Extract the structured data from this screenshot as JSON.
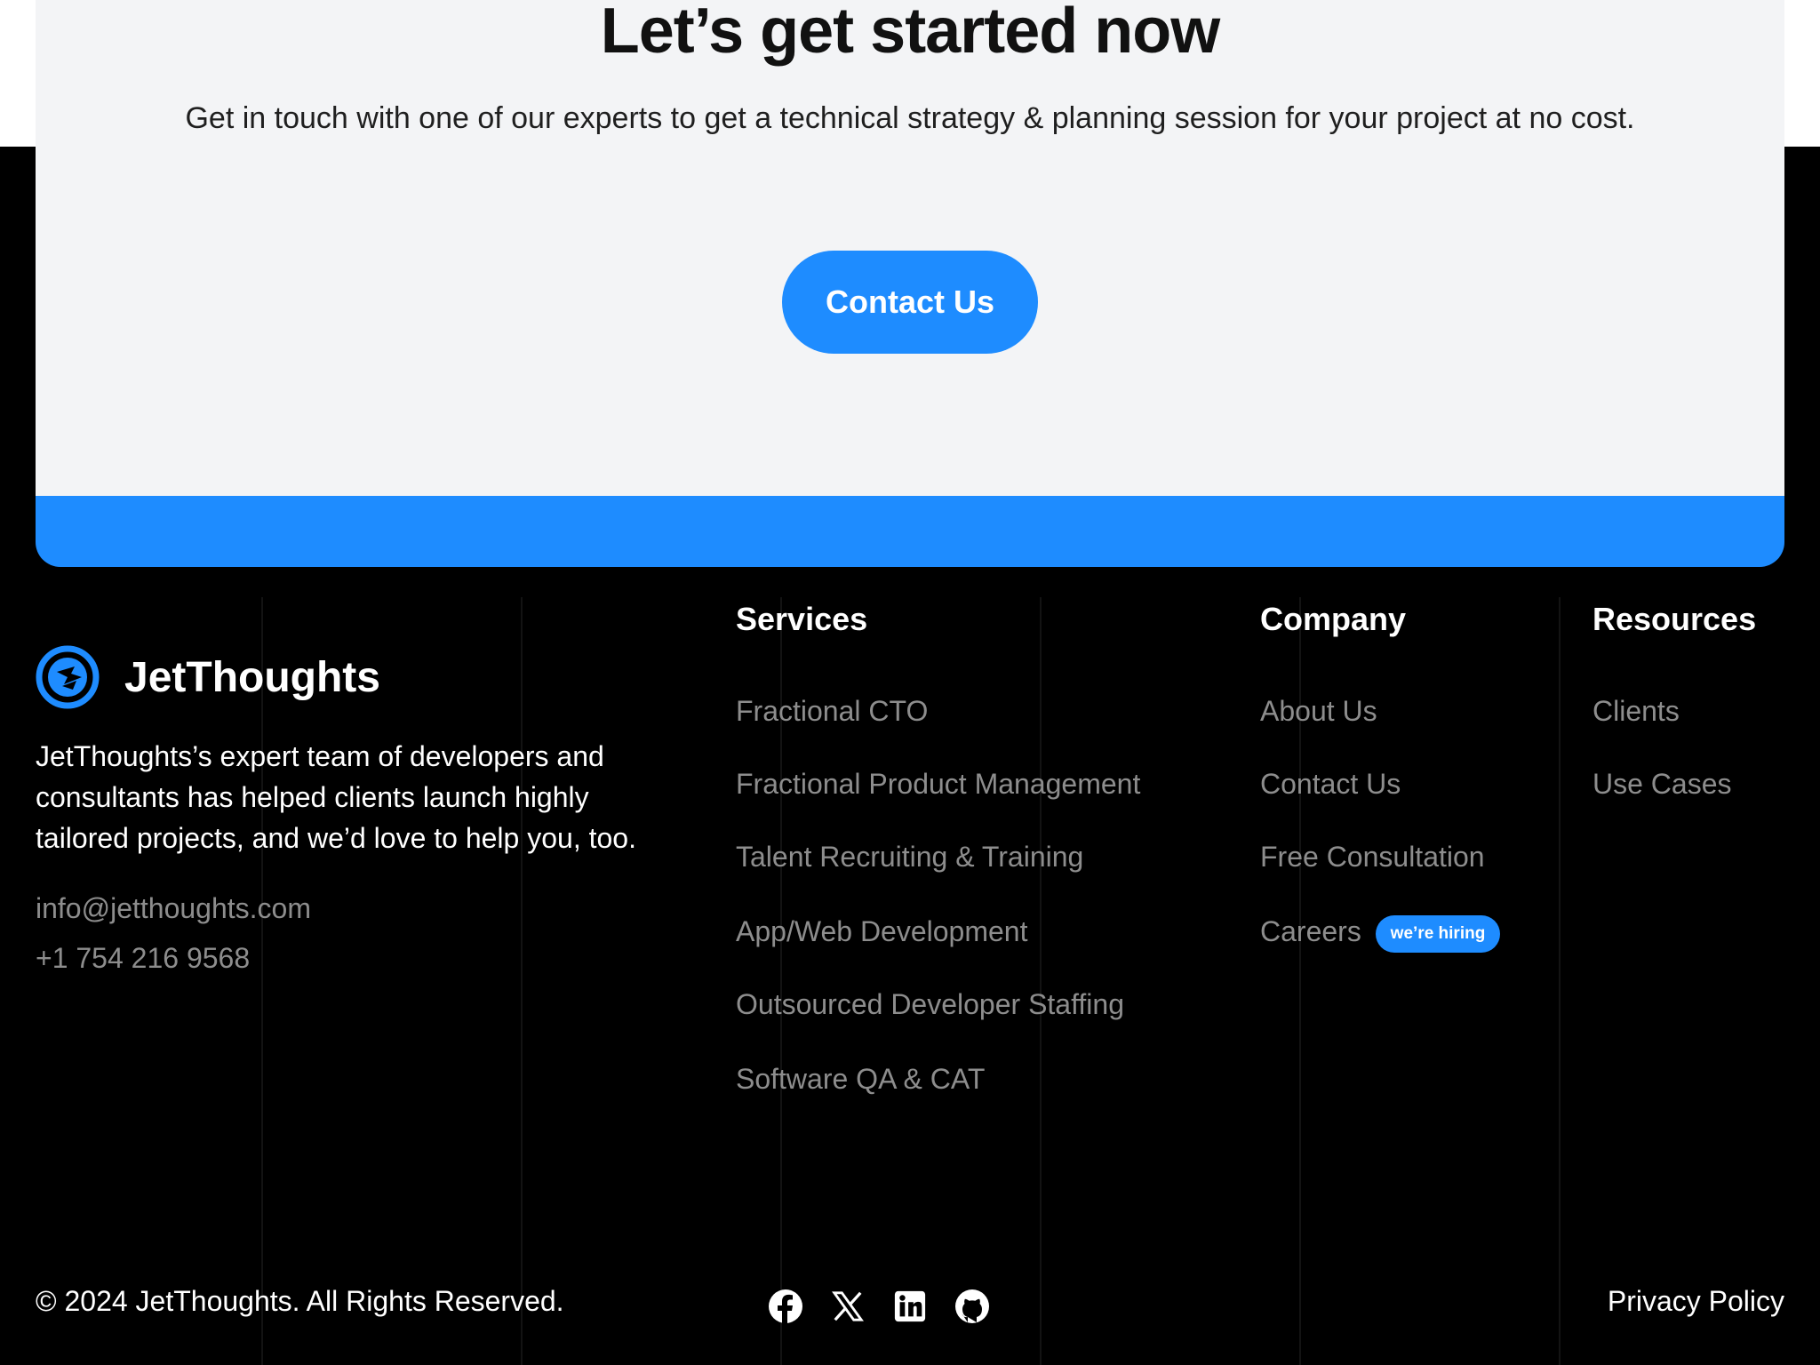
{
  "cta": {
    "title": "Let’s get started now",
    "subtitle": "Get in touch with one of our experts to get a technical strategy & planning session for your project at no cost.",
    "button_label": "Contact Us"
  },
  "brand": {
    "name": "JetThoughts",
    "description": "JetThoughts’s expert team of developers and consultants has helped clients launch highly tailored projects, and we’d love to help you, too.",
    "email": "info@jetthoughts.com",
    "phone": "+1 754 216 9568"
  },
  "services": {
    "title": "Services",
    "items": [
      "Fractional CTO",
      "Fractional Product Management",
      "Talent Recruiting & Training",
      "App/Web Development",
      "Outsourced Developer Staffing",
      "Software QA & CAT"
    ]
  },
  "company": {
    "title": "Company",
    "items": [
      "About Us",
      "Contact Us",
      "Free Consultation",
      "Careers"
    ],
    "hiring_badge": "we’re hiring"
  },
  "resources": {
    "title": "Resources",
    "items": [
      "Clients",
      "Use Cases"
    ]
  },
  "footer": {
    "copyright": "© 2024 JetThoughts. All Rights Reserved.",
    "privacy_label": "Privacy Policy",
    "social_icons": [
      "facebook-icon",
      "x-icon",
      "linkedin-icon",
      "github-icon"
    ]
  },
  "colors": {
    "accent": "#1e8cff",
    "card_bg": "#f3f4f6",
    "footer_bg": "#000000",
    "muted_text": "#8d8d8d"
  }
}
